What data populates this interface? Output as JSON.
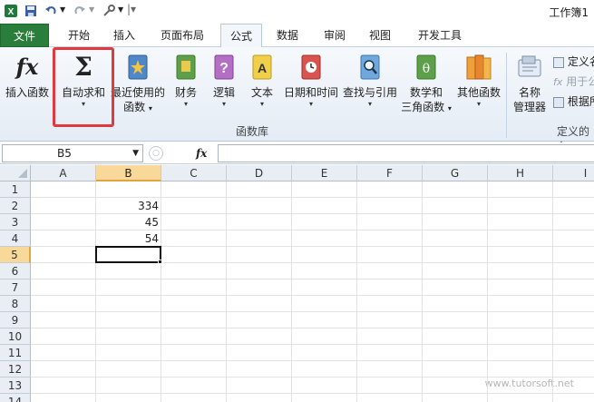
{
  "title_bar": {
    "quick_access_icons": [
      "excel-logo-icon",
      "save-icon",
      "undo-icon",
      "redo-icon",
      "customize-icon"
    ],
    "window_title": "工作簿1"
  },
  "tabs": [
    {
      "label": "文件",
      "active": false
    },
    {
      "label": "开始",
      "active": false
    },
    {
      "label": "插入",
      "active": false
    },
    {
      "label": "页面布局",
      "active": false
    },
    {
      "label": "公式",
      "active": true
    },
    {
      "label": "数据",
      "active": false
    },
    {
      "label": "审阅",
      "active": false
    },
    {
      "label": "视图",
      "active": false
    },
    {
      "label": "开发工具",
      "active": false
    }
  ],
  "ribbon": {
    "insert_function": {
      "label": "插入函数",
      "icon": "fx-icon"
    },
    "autosum": {
      "label": "自动求和",
      "icon": "sigma-icon"
    },
    "recent": {
      "label_line1": "最近使用的",
      "label_line2": "函数",
      "icon": "star-book-icon"
    },
    "financial": {
      "label": "财务",
      "icon": "financial-book-icon"
    },
    "logical": {
      "label": "逻辑",
      "icon": "question-book-icon"
    },
    "text": {
      "label": "文本",
      "icon": "text-book-icon"
    },
    "datetime": {
      "label": "日期和时间",
      "icon": "clock-book-icon"
    },
    "lookup": {
      "label": "查找与引用",
      "icon": "magnifier-book-icon"
    },
    "math": {
      "label_line1": "数学和",
      "label_line2": "三角函数",
      "icon": "theta-book-icon"
    },
    "more": {
      "label": "其他函数",
      "icon": "books-icon"
    },
    "function_library_label": "函数库",
    "name_manager": {
      "label_line1": "名称",
      "label_line2": "管理器",
      "icon": "name-manager-icon"
    },
    "define_name": "定义名",
    "use_in_formula": "用于公",
    "create_from_selection": "根据所",
    "defined_names_label": "定义的名"
  },
  "formula_bar": {
    "name_box": "B5",
    "fx": "fx",
    "formula": ""
  },
  "sheet": {
    "columns": [
      "A",
      "B",
      "C",
      "D",
      "E",
      "F",
      "G",
      "H",
      "I"
    ],
    "rows": [
      "1",
      "2",
      "3",
      "4",
      "5",
      "6",
      "7",
      "8",
      "9",
      "10",
      "11",
      "12",
      "13",
      "14"
    ],
    "selected_column": "B",
    "selected_row": "5",
    "cells": {
      "B2": "334",
      "B3": "45",
      "B4": "54"
    }
  },
  "colors": {
    "file_tab": "#2a7d3a",
    "highlight_box": "#e0393e",
    "selection_header": "#f9d999"
  },
  "watermark": "www.tutorsoft.net"
}
